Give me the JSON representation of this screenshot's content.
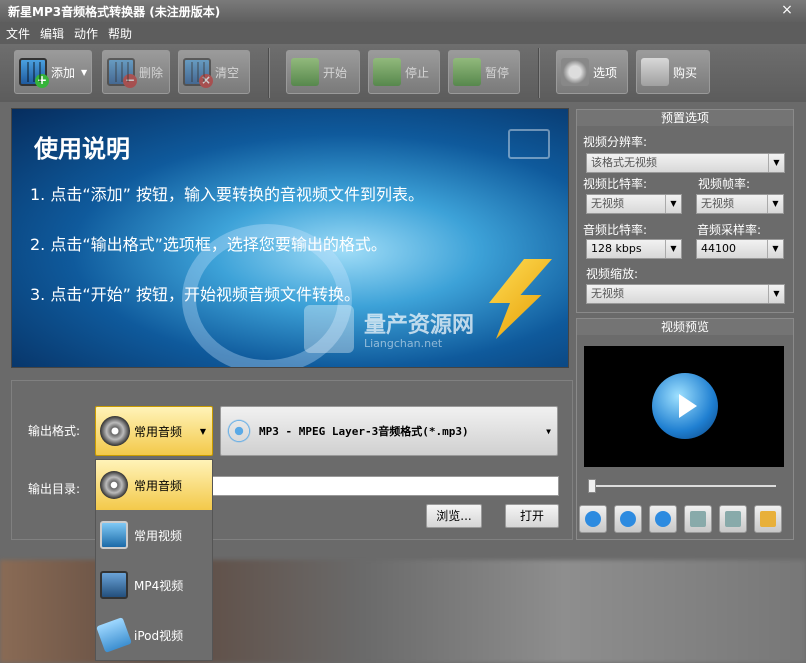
{
  "window": {
    "title": "新星MP3音频格式转换器 (未注册版本)",
    "close": "×"
  },
  "menu": [
    "文件",
    "编辑",
    "动作",
    "帮助"
  ],
  "toolbar": {
    "add": "添加",
    "delete": "删除",
    "clear": "清空",
    "start": "开始",
    "stop": "停止",
    "pause": "暂停",
    "options": "选项",
    "buy": "购买"
  },
  "banner": {
    "title": "使用说明",
    "step1": "1. 点击“添加”  按钮，输入要转换的音视频文件到列表。",
    "step2": "2. 点击“输出格式”选项框，选择您要输出的格式。",
    "step3": "3. 点击“开始”  按钮，开始视频音频文件转换。",
    "watermark": "量产资源网",
    "watermark_sub": "Liangchan.net"
  },
  "output": {
    "format_label": "输出格式:",
    "format_value": "常用音频",
    "codec_value": "MP3 - MPEG Layer-3音频格式(*.mp3)",
    "dir_label": "输出目录:",
    "dir_value": "",
    "browse": "浏览...",
    "open": "打开"
  },
  "dropdown": {
    "items": [
      "常用音频",
      "常用视频",
      "MP4视频",
      "iPod视频"
    ]
  },
  "preset": {
    "header": "预置选项",
    "video_resolution_label": "视频分辨率:",
    "video_resolution_value": "该格式无视频",
    "video_bitrate_label": "视频比特率:",
    "video_bitrate_value": "无视频",
    "video_fps_label": "视频帧率:",
    "video_fps_value": "无视频",
    "audio_bitrate_label": "音频比特率:",
    "audio_bitrate_value": "128 kbps",
    "audio_samplerate_label": "音频采样率:",
    "audio_samplerate_value": "44100",
    "video_zoom_label": "视频缩放:",
    "video_zoom_value": "无视频"
  },
  "preview": {
    "header": "视频预览",
    "seek_position": 0
  },
  "colors": {
    "accent_yellow": "#f3c94a",
    "play_blue": "#1f7fd1",
    "bg": "#6a6a6a"
  }
}
